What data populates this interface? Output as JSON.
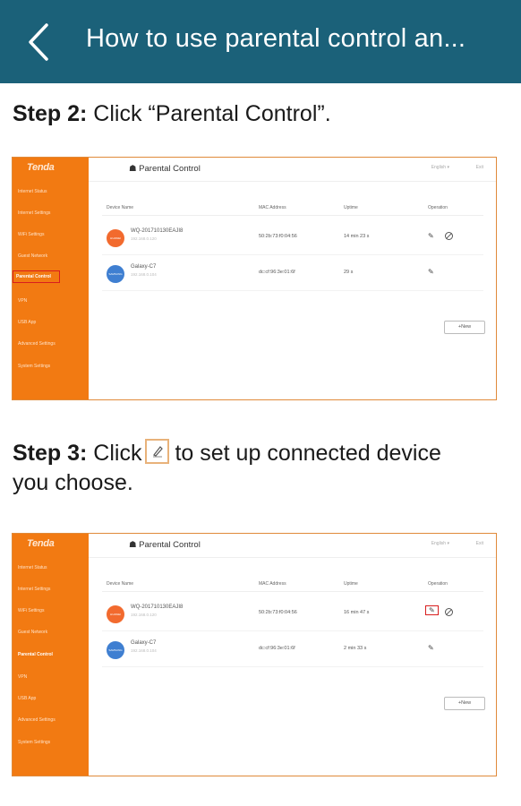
{
  "appbar": {
    "title": "How to use parental control an..."
  },
  "step2": {
    "label": "Step 2:",
    "text": " Click “Parental Control”."
  },
  "step3": {
    "label": "Step 3:",
    "text_before": " Click",
    "text_after": "to set up connected device",
    "text_line2": "you choose."
  },
  "screenshot1": {
    "brand": "Tenda",
    "menu": [
      "Internet Status",
      "Internet Settings",
      "WiFi Settings",
      "Guest Network",
      "Parental Control",
      "VPN",
      "USB App",
      "Advanced Settings",
      "System Settings"
    ],
    "title": "Parental Control",
    "lang": "English ▾",
    "exit": "Exit",
    "columns": [
      "Device Name",
      "MAC Address",
      "Uptime",
      "Operation"
    ],
    "rows": [
      {
        "avatar": "HUAWEI",
        "avatar_color": "#f26a2e",
        "name": "WQ-201710130EAJI8",
        "ip": "192.168.0.120",
        "mac": "50:2b:73:f0:04:56",
        "uptime": "14 min 23 s"
      },
      {
        "avatar": "SAMSUNG",
        "avatar_color": "#3f7fd1",
        "name": "Galaxy-C7",
        "ip": "192.168.0.104",
        "mac": "dc:cf:96:3e:01:6f",
        "uptime": "29 s"
      }
    ],
    "new_button": "+New"
  },
  "screenshot2": {
    "brand": "Tenda",
    "menu": [
      "Internet Status",
      "Internet Settings",
      "WiFi Settings",
      "Guest Network",
      "Parental Control",
      "VPN",
      "USB App",
      "Advanced Settings",
      "System Settings"
    ],
    "title": "Parental Control",
    "lang": "English ▾",
    "exit": "Exit",
    "columns": [
      "Device Name",
      "MAC Address",
      "Uptime",
      "Operation"
    ],
    "rows": [
      {
        "avatar": "HUAWEI",
        "avatar_color": "#f26a2e",
        "name": "WQ-201710130EAJI8",
        "ip": "192.168.0.120",
        "mac": "50:2b:73:f0:04:56",
        "uptime": "16 min 47 s"
      },
      {
        "avatar": "SAMSUNG",
        "avatar_color": "#3f7fd1",
        "name": "Galaxy-C7",
        "ip": "192.168.0.104",
        "mac": "dc:cf:96:3e:01:6f",
        "uptime": "2 min 33 s"
      }
    ],
    "new_button": "+New"
  },
  "colors": {
    "appbar": "#1b6179",
    "sidebar": "#f27a12",
    "highlight": "#d81e1e"
  }
}
